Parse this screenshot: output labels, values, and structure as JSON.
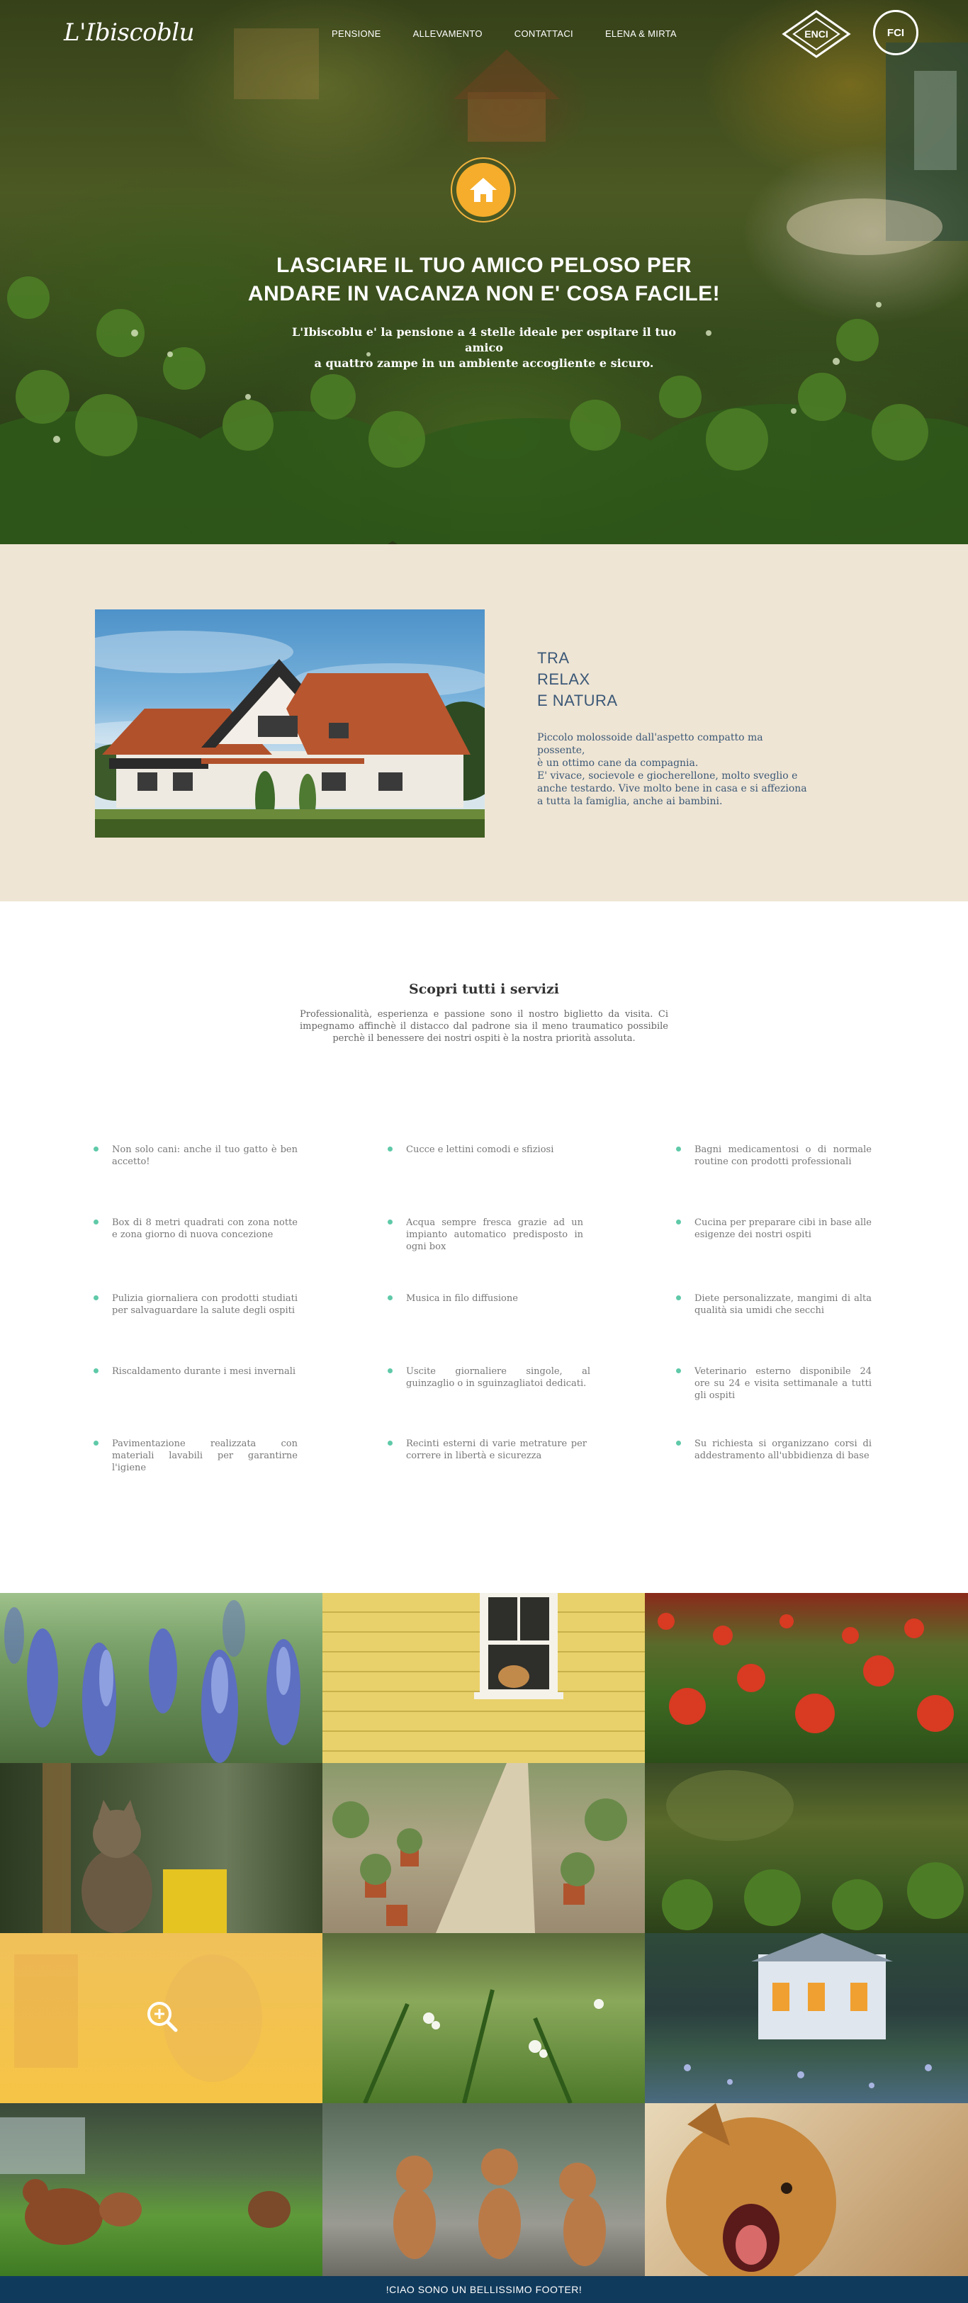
{
  "header": {
    "logo": "L'Ibiscoblu",
    "nav": [
      "PENSIONE",
      "ALLEVAMENTO",
      "CONTATTACI",
      "ELENA & MIRTA"
    ],
    "badges": [
      "ENCI",
      "FCI"
    ]
  },
  "hero": {
    "title_line1": "LASCIARE IL TUO AMICO PELOSO PER",
    "title_line2": "ANDARE IN VACANZA NON E' COSA FACILE!",
    "subtitle_line1": "L'Ibiscoblu e' la pensione a 4 stelle ideale per ospitare il tuo amico",
    "subtitle_line2": "a quattro zampe in un ambiente accogliente e sicuro."
  },
  "about": {
    "heading": [
      "TRA",
      "RELAX",
      "E NATURA"
    ],
    "text_lines": [
      "Piccolo molossoide dall'aspetto compatto ma possente,",
      "è un ottimo cane da compagnia.",
      "E' vivace, socievole e giocherellone, molto sveglio e",
      "anche testardo. Vive molto bene in casa e si affeziona",
      "a tutta la famiglia, anche ai bambini."
    ]
  },
  "services": {
    "title": "Scopri tutti i servizi",
    "intro": "Professionalità, esperienza e passione sono il nostro biglietto da visita. Ci impegnamo affinchè il distacco dal padrone sia il meno traumatico possibile perchè il benessere dei nostri ospiti è la nostra priorità assoluta.",
    "items": [
      "Non solo cani: anche il tuo gatto è ben accetto!",
      "Cucce e lettini comodi e sfiziosi",
      "Bagni medicamentosi o di normale routine con prodotti professionali",
      "Box di 8 metri quadrati con zona notte e zona giorno di nuova concezione",
      "Acqua sempre fresca grazie ad un impianto automatico predisposto in ogni box",
      "Cucina per preparare cibi in base alle esigenze dei nostri ospiti",
      "Pulizia giornaliera con prodotti studiati per salvaguardare la salute degli ospiti",
      "Musica in filo diffusione",
      "Diete personalizzate, mangimi di alta qualità sia umidi che secchi",
      "Riscaldamento durante i mesi invernali",
      "Uscite giornaliere singole, al guinzaglio o in sguinzagliatoi dedicati.",
      "Veterinario esterno disponibile 24 ore su 24 e visita settimanale a tutti gli ospiti",
      "Pavimentazione realizzata con materiali lavabili per garantirne l'igiene",
      "Recinti esterni di varie metrature per correre in libertà e sicurezza",
      "Su richiesta si organizzano corsi di addestramento all'ubbidienza di base"
    ]
  },
  "gallery": {
    "tiles": [
      "hyacinths",
      "dog-in-window",
      "poppies",
      "cat",
      "greenhouse",
      "garden",
      "zoom-overlay",
      "flowers",
      "house-at-dusk",
      "hens",
      "puppies",
      "dog-yawning"
    ]
  },
  "footer": {
    "text": "!CIAO SONO UN BELLISSIMO FOOTER!"
  },
  "colors": {
    "accent": "#f5ad2b",
    "about_bg": "#efe5d4",
    "navy": "#103a5c",
    "bullet": "#5fc9a8",
    "overlay": "#f6c445"
  }
}
